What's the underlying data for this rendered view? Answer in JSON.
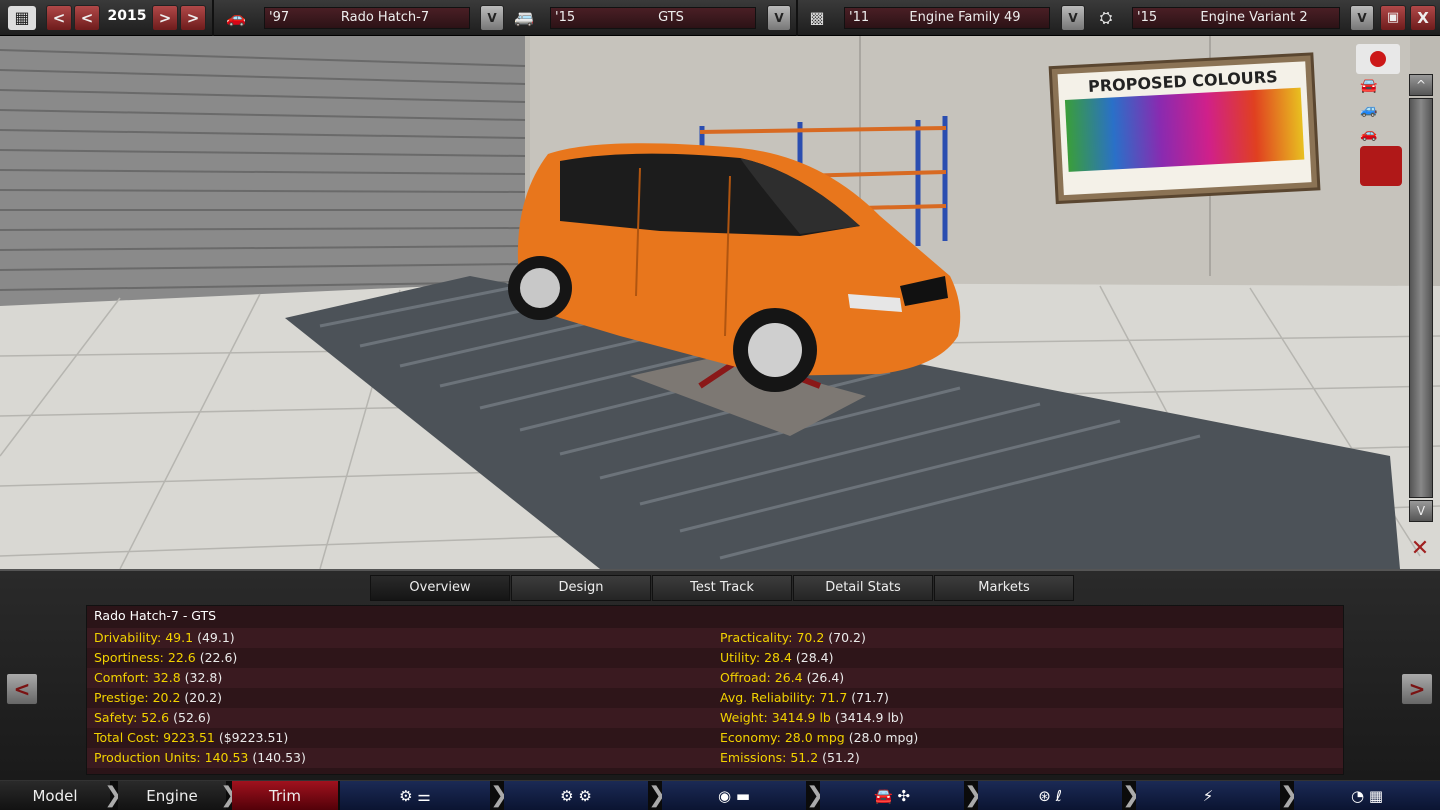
{
  "topbar": {
    "year": "2015",
    "prev_fast": "<",
    "prev": "<",
    "next": ">",
    "next_fast": ">",
    "model": {
      "year": "'97",
      "name": "Rado Hatch-7"
    },
    "trim": {
      "year": "'15",
      "name": "GTS"
    },
    "engine_family": {
      "year": "'11",
      "name": "Engine Family 49"
    },
    "engine_variant": {
      "year": "'15",
      "name": "Engine Variant 2"
    },
    "dropdown": "V",
    "close": "X"
  },
  "scene": {
    "poster_title": "PROPOSED COLOURS",
    "car_color": "#e8761c"
  },
  "rail": {
    "up": "^",
    "down": "V"
  },
  "tabs": [
    {
      "label": "Overview"
    },
    {
      "label": "Design"
    },
    {
      "label": "Test Track"
    },
    {
      "label": "Detail Stats"
    },
    {
      "label": "Markets"
    }
  ],
  "stats": {
    "title": "Rado Hatch-7 - GTS",
    "left": [
      {
        "label": "Drivability:",
        "value": "49.1",
        "paren": "(49.1)"
      },
      {
        "label": "Sportiness:",
        "value": "22.6",
        "paren": "(22.6)"
      },
      {
        "label": "Comfort:",
        "value": "32.8",
        "paren": "(32.8)"
      },
      {
        "label": "Prestige:",
        "value": "20.2",
        "paren": "(20.2)"
      },
      {
        "label": "Safety:",
        "value": "52.6",
        "paren": "(52.6)"
      },
      {
        "label": "Total Cost:",
        "value": "9223.51",
        "paren": "($9223.51)"
      },
      {
        "label": "Production Units:",
        "value": "140.53",
        "paren": "(140.53)"
      }
    ],
    "right": [
      {
        "label": "Practicality:",
        "value": "70.2",
        "paren": "(70.2)"
      },
      {
        "label": "Utility:",
        "value": "28.4",
        "paren": "(28.4)"
      },
      {
        "label": "Offroad:",
        "value": "26.4",
        "paren": "(26.4)"
      },
      {
        "label": "Avg. Reliability:",
        "value": "71.7",
        "paren": "(71.7)"
      },
      {
        "label": "Weight:",
        "value": "3414.9 lb",
        "paren": "(3414.9 lb)"
      },
      {
        "label": "Economy:",
        "value": "28.0 mpg",
        "paren": "(28.0 mpg)"
      },
      {
        "label": "Emissions:",
        "value": "51.2",
        "paren": "(51.2)"
      }
    ],
    "prev": "<",
    "next": ">"
  },
  "nav": {
    "model": "Model",
    "engine": "Engine",
    "trim": "Trim"
  }
}
